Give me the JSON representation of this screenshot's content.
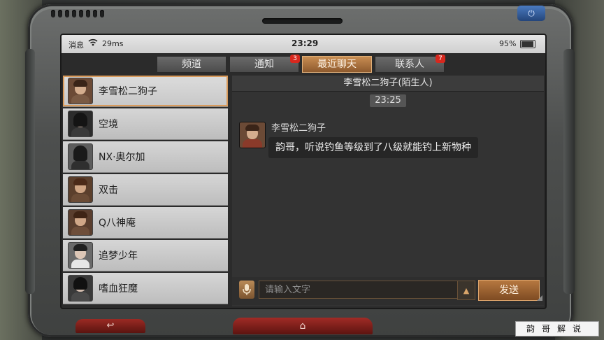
{
  "status_bar": {
    "message_label": "消息",
    "wifi_icon": "wifi-icon",
    "rate": "29ms",
    "time": "23:29",
    "battery": "95%"
  },
  "tabs": [
    {
      "label": "频道",
      "badge": ""
    },
    {
      "label": "通知",
      "badge": "3"
    },
    {
      "label": "最近聊天",
      "badge": ""
    },
    {
      "label": "联系人",
      "badge": "7"
    }
  ],
  "active_tab": "最近聊天",
  "contacts": [
    {
      "name": "李雪松二狗子",
      "selected": true
    },
    {
      "name": "空境",
      "selected": false
    },
    {
      "name": "NX·奥尔加",
      "selected": false
    },
    {
      "name": "双击",
      "selected": false
    },
    {
      "name": "Q八神庵",
      "selected": false
    },
    {
      "name": "追梦少年",
      "selected": false
    },
    {
      "name": "嗜血狂魔",
      "selected": false
    }
  ],
  "chat": {
    "header": "李雪松二狗子(陌生人)",
    "timestamp": "23:25",
    "message": {
      "sender": "李雪松二狗子",
      "text": "韵哥，听说钓鱼等级到了八级就能钓上新物种"
    },
    "input_placeholder": "请输入文字",
    "send_label": "发送"
  },
  "bottom": {
    "back_icon": "return-arrow-icon",
    "back_label": "↩",
    "home_icon": "home-icon",
    "home_label": "⌂"
  },
  "watermark": "韵哥解说",
  "colors": {
    "accent": "#c88d52",
    "badge": "#d8281e",
    "home_button": "#a12c26"
  }
}
